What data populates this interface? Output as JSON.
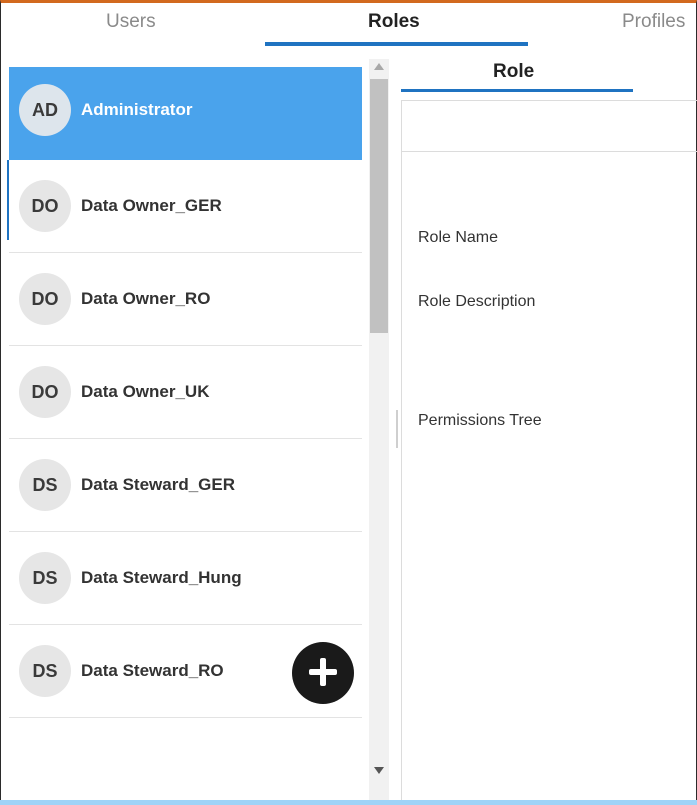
{
  "tabs": {
    "users": "Users",
    "roles": "Roles",
    "profiles": "Profiles",
    "active": "Roles"
  },
  "roles": [
    {
      "initials": "AD",
      "name": "Administrator",
      "selected": true
    },
    {
      "initials": "DO",
      "name": "Data Owner_GER"
    },
    {
      "initials": "DO",
      "name": "Data Owner_RO"
    },
    {
      "initials": "DO",
      "name": "Data Owner_UK"
    },
    {
      "initials": "DS",
      "name": "Data Steward_GER"
    },
    {
      "initials": "DS",
      "name": "Data Steward_Hung"
    },
    {
      "initials": "DS",
      "name": "Data Steward_RO"
    }
  ],
  "detail": {
    "tab": "Role",
    "role_name_label": "Role Name",
    "role_description_label": "Role Description",
    "permissions_tree_label": "Permissions Tree"
  },
  "icons": {
    "add_button": "plus-icon"
  },
  "colors": {
    "accent": "#1f73c1",
    "selected_row": "#4aa3ec",
    "top_border": "#d2691e",
    "fab": "#1a1a1a"
  }
}
